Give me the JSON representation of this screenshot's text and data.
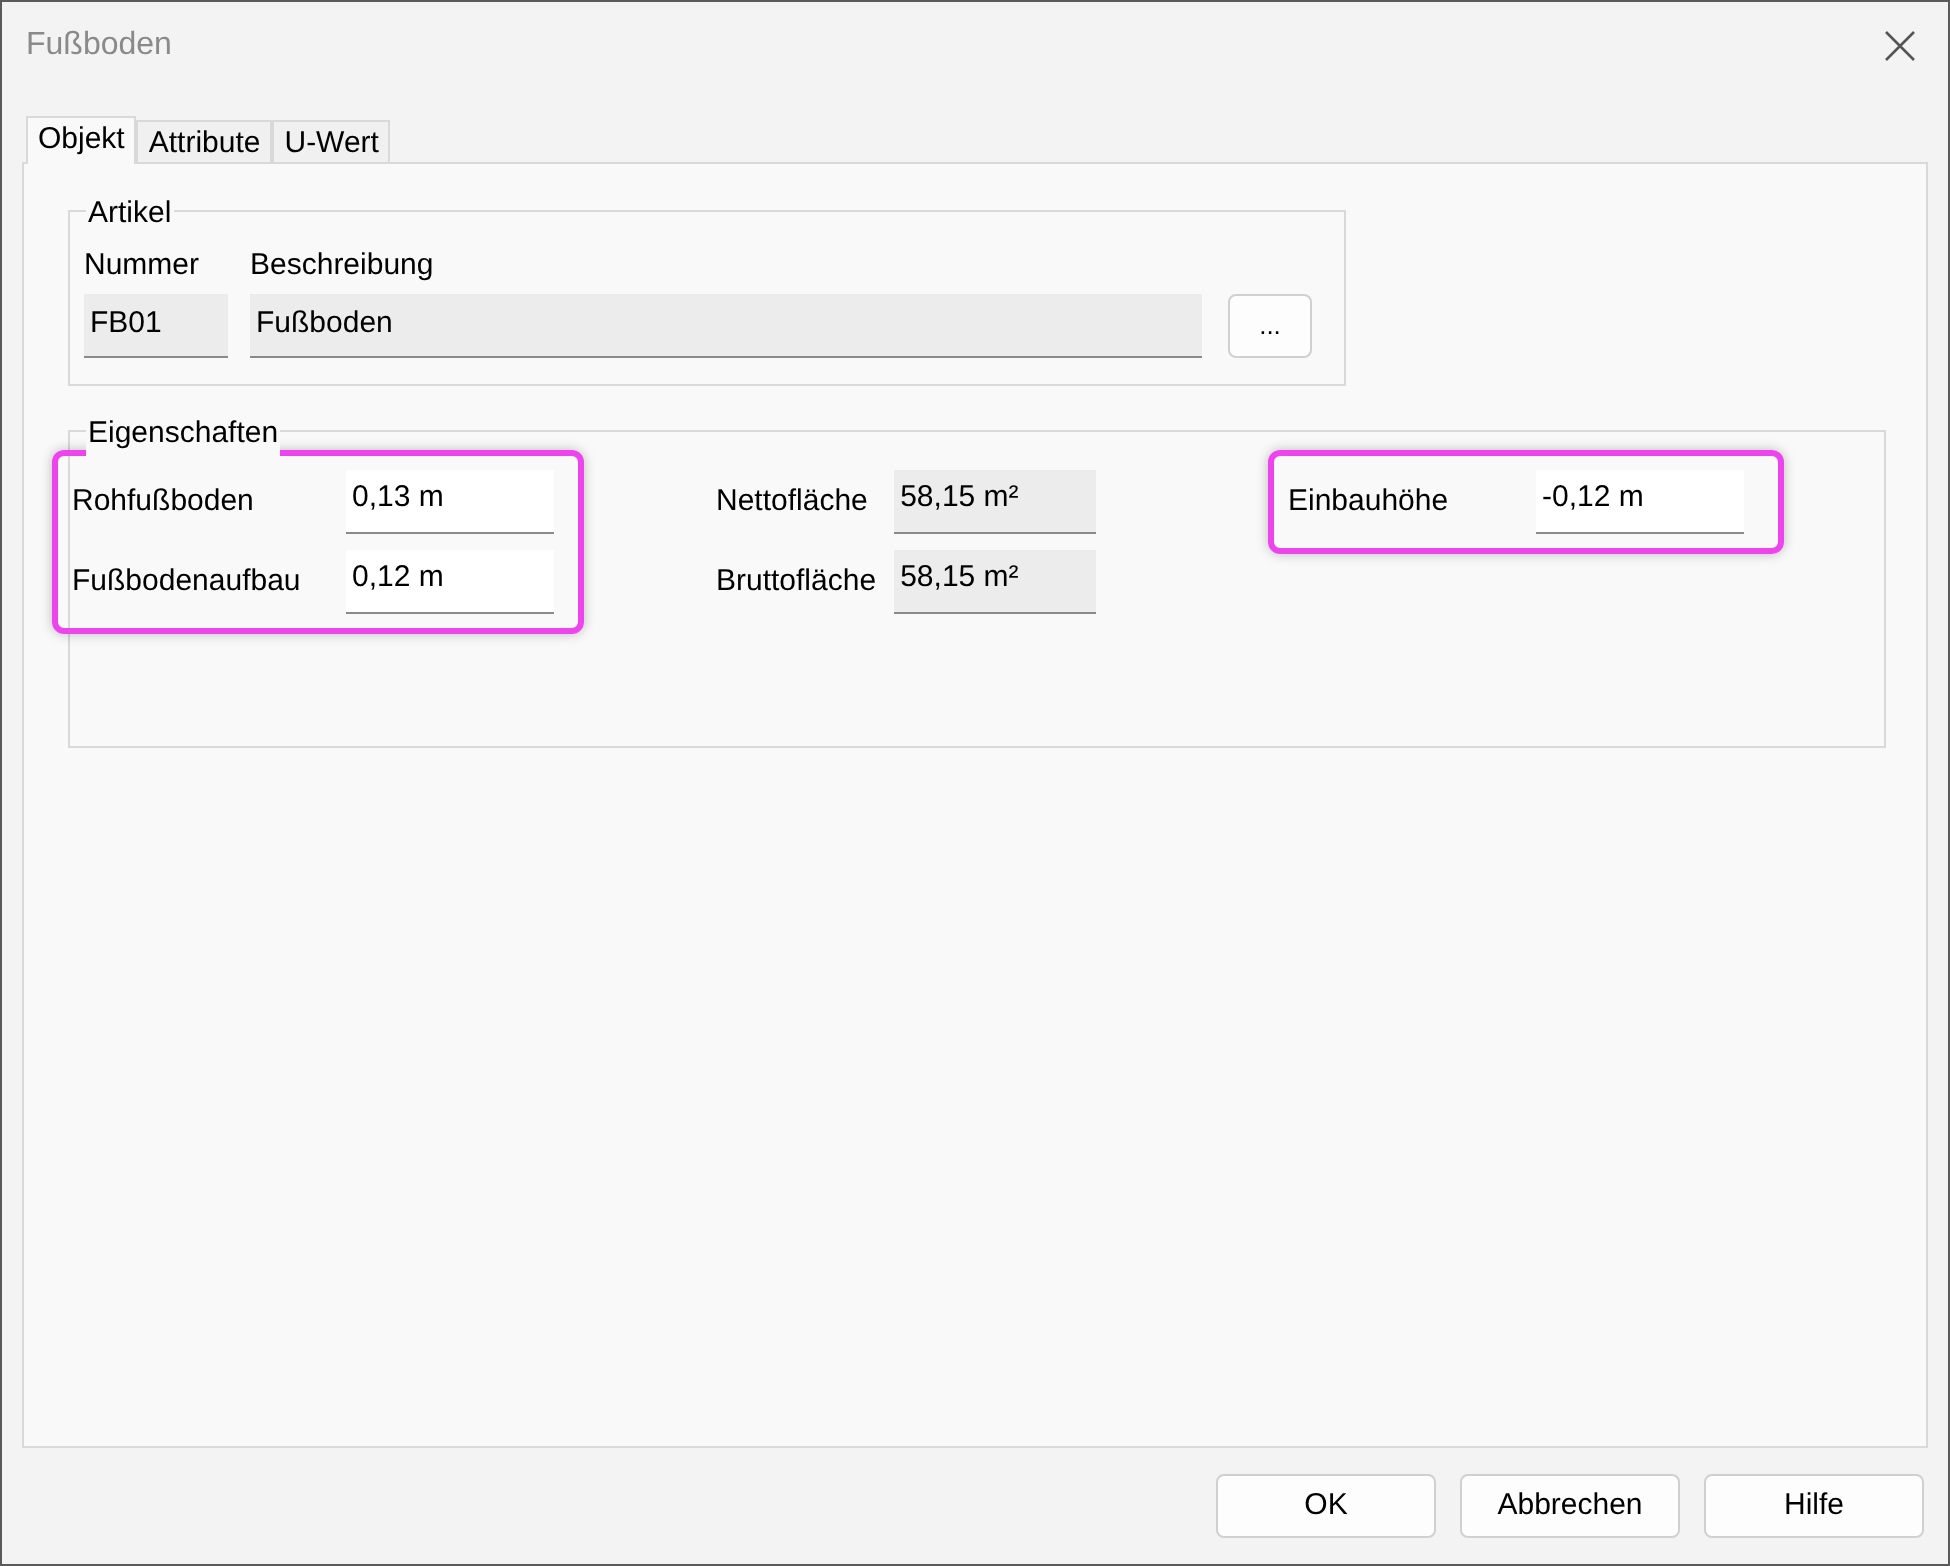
{
  "window": {
    "title": "Fußboden"
  },
  "tabs": [
    {
      "label": "Objekt",
      "selected": true
    },
    {
      "label": "Attribute",
      "selected": false
    },
    {
      "label": "U-Wert",
      "selected": false
    }
  ],
  "artikel": {
    "title": "Artikel",
    "number_label": "Nummer",
    "number_value": "FB01",
    "description_label": "Beschreibung",
    "description_value": "Fußboden",
    "browse_button": "..."
  },
  "eigenschaften": {
    "title": "Eigenschaften",
    "groups": [
      {
        "highlighted": true,
        "fields": [
          {
            "label": "Rohfußboden",
            "value": "0,13 m",
            "editable": true
          },
          {
            "label": "Fußbodenaufbau",
            "value": "0,12 m",
            "editable": true
          }
        ]
      },
      {
        "highlighted": false,
        "fields": [
          {
            "label": "Nettofläche",
            "value": "58,15 m²",
            "editable": false
          },
          {
            "label": "Bruttofläche",
            "value": "58,15 m²",
            "editable": false
          }
        ]
      },
      {
        "highlighted": true,
        "fields": [
          {
            "label": "Einbauhöhe",
            "value": "-0,12 m",
            "editable": true
          }
        ]
      }
    ]
  },
  "buttons": [
    "OK",
    "Abbrechen",
    "Hilfe"
  ]
}
